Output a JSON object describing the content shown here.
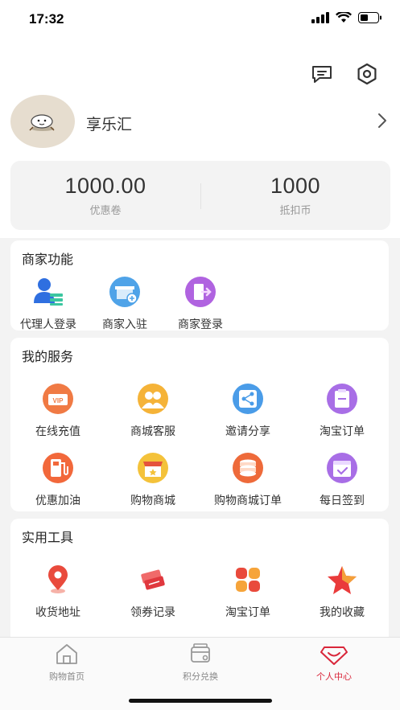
{
  "status_bar": {
    "time": "17:32"
  },
  "user": {
    "name": "享乐汇"
  },
  "stats": [
    {
      "value": "1000.00",
      "label": "优惠卷"
    },
    {
      "value": "1000",
      "label": "抵扣币"
    }
  ],
  "merchant": {
    "title": "商家功能",
    "items": [
      {
        "label": "代理人登录",
        "icon": "agent-login-icon"
      },
      {
        "label": "商家入驻",
        "icon": "merchant-join-icon"
      },
      {
        "label": "商家登录",
        "icon": "merchant-login-icon"
      }
    ]
  },
  "services": {
    "title": "我的服务",
    "items": [
      {
        "label": "在线充值",
        "icon": "vip-recharge-icon"
      },
      {
        "label": "商城客服",
        "icon": "customer-service-icon"
      },
      {
        "label": "邀请分享",
        "icon": "share-icon"
      },
      {
        "label": "淘宝订单",
        "icon": "order-icon"
      },
      {
        "label": "优惠加油",
        "icon": "fuel-icon"
      },
      {
        "label": "购物商城",
        "icon": "store-icon"
      },
      {
        "label": "购物商城订单",
        "icon": "coins-icon"
      },
      {
        "label": "每日签到",
        "icon": "calendar-check-icon"
      }
    ]
  },
  "tools": {
    "title": "实用工具",
    "items": [
      {
        "label": "收货地址",
        "icon": "location-pin-icon"
      },
      {
        "label": "领券记录",
        "icon": "tickets-icon"
      },
      {
        "label": "淘宝订单",
        "icon": "clover-icon"
      },
      {
        "label": "我的收藏",
        "icon": "star-icon"
      }
    ]
  },
  "tabbar": [
    {
      "label": "购物首页",
      "icon": "home-icon",
      "active": false
    },
    {
      "label": "积分兑换",
      "icon": "exchange-icon",
      "active": false
    },
    {
      "label": "个人中心",
      "icon": "profile-diamond-icon",
      "active": true
    }
  ],
  "colors": {
    "accent": "#d9263a",
    "background": "#f3f3f3"
  }
}
